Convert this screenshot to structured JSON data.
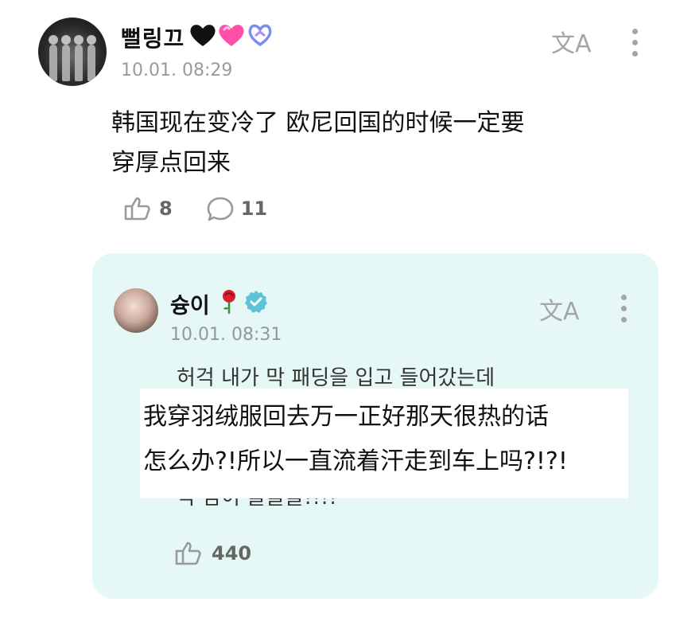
{
  "post": {
    "username": "뻘링끄",
    "timestamp": "10.01. 08:29",
    "text_line1": "韩国现在变冷了 欧尼回国的时候一定要",
    "text_line2": "穿厚点回来",
    "likes": "8",
    "comments": "11",
    "translate_label": "文A"
  },
  "reply": {
    "username": "슝이",
    "timestamp": "10.01. 08:31",
    "korean_visible_top": "허걱 내가 막 패딩을 입고 들어갔는데",
    "korean_visible_bottom": "딱 땀이 줄줄줄!!!!",
    "overlay_line1": "我穿羽绒服回去万一正好那天很热的话",
    "overlay_line2": "怎么办?!所以一直流着汗走到车上吗?!?!",
    "likes": "440",
    "translate_label": "文A"
  },
  "colors": {
    "card_bg": "#e6f8f5",
    "verified": "#5fc3d8",
    "icon_grey": "#a5a5a5"
  }
}
